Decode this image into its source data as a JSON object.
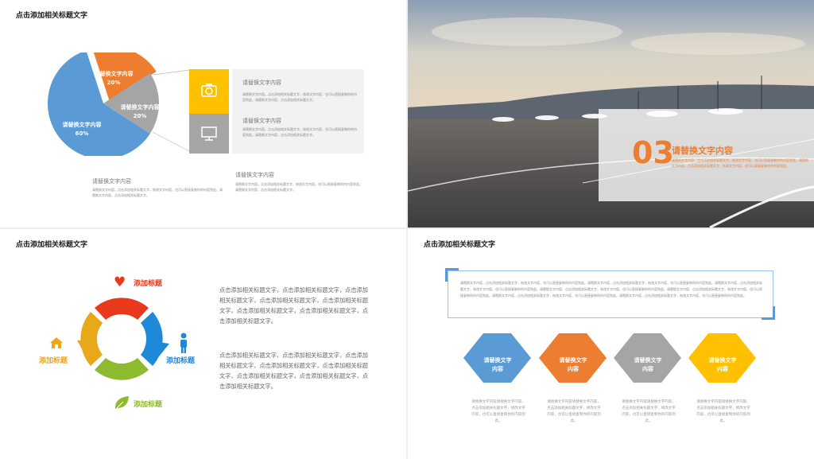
{
  "slide1": {
    "title": "点击添加相关标题文字",
    "pie": [
      {
        "label": "请替换文字内容",
        "percent": "20%",
        "value": 20,
        "color": "#ed7d31"
      },
      {
        "label": "请替换文字内容",
        "percent": "20%",
        "value": 20,
        "color": "#a5a5a5"
      },
      {
        "label": "请替换文字内容",
        "percent": "60%",
        "value": 60,
        "color": "#5b9bd5"
      }
    ],
    "panel_heading_1": "请替换文字内容",
    "panel_text_1": "请替换文字内容。点击添加相关标题文字，修改文字内容，也可以直接复制你的内容到此。请替换文字内容，点击添加相关标题文字。",
    "panel_heading_2": "请替换文字内容",
    "panel_text_2": "请替换文字内容。点击添加相关标题文字，修改文字内容，也可以直接复制你的内容到此。请替换文字内容，点击添加相关标题文字。",
    "bottom_heading_1": "请替换文字内容",
    "bottom_text_1": "请替换文字内容。点击添加相关标题文字，修改文字内容，也可以直接复制你的内容到此。请替换文字内容，点击添加相关标题文字。",
    "bottom_heading_2": "请替换文字内容",
    "bottom_text_2": "请替换文字内容。点击添加相关标题文字，修改文字内容，也可以直接复制你的内容到此。请替换文字内容，点击添加相关标题文字。",
    "icons": [
      "camera-icon",
      "monitor-icon"
    ]
  },
  "slide2": {
    "number": "03",
    "heading": "请替换文字内容",
    "text": "请替换文字内容。点击添加相关标题文字，修改文字内容，也可以直接复制你的内容到此。请替换文字内容，点击添加相关标题文字，修改文字内容，也可以直接复制你的内容到此。",
    "accent": "#ed7d31"
  },
  "slide3": {
    "title": "点击添加相关标题文字",
    "labels": {
      "top": "添加标题",
      "right": "添加标题",
      "bottom": "添加标题",
      "left": "添加标题"
    },
    "icons": [
      "heart-icon",
      "person-icon",
      "leaf-icon",
      "house-icon"
    ],
    "paragraph_1": "点击添加相关标题文字，点击添加相关标题文字，点击添加相关标题文字，点击添加相关标题文字，点击添加相关标题文字，点击添加相关标题文字，点击添加相关标题文字，点击添加相关标题文字。",
    "paragraph_2": "点击添加相关标题文字，点击添加相关标题文字，点击添加相关标题文字，点击添加相关标题文字，点击添加相关标题文字，点击添加相关标题文字，点击添加相关标题文字，点击添加相关标题文字。"
  },
  "slide4": {
    "title": "点击添加相关标题文字",
    "box_text": "请替换文字内容，点击添加相关标题文字，修改文字内容，也可以直接复制你的内容到此。请替换文字内容，点击添加相关标题文字，修改文字内容，也可以直接复制你的内容到此。请替换文字内容，点击添加相关标题文字，修改文字内容，也可以直接复制你的内容到此。请替换文字内容，点击添加相关标题文字，修改文字内容，也可以直接复制你的内容到此。请替换文字内容，点击添加相关标题文字，修改文字内容，也可以直接复制你的内容到此。请替换文字内容，点击添加相关标题文字，修改文字内容，也可以直接复制你的内容到此。请替换文字内容，点击添加相关标题文字，修改文字内容，也可以直接复制你的内容到此。",
    "hexes": [
      {
        "label1": "请替换文字",
        "label2": "内容",
        "color": "#5b9bd5",
        "text": "请替换文字内容请替换文字内容，点击添加相关标题文字，修改文字内容，也可以直接复制你的内容到此。"
      },
      {
        "label1": "请替换文字",
        "label2": "内容",
        "color": "#ed7d31",
        "text": "请替换文字内容请替换文字内容，点击添加相关标题文字，修改文字内容，也可以直接复制你的内容到此。"
      },
      {
        "label1": "请替换文字",
        "label2": "内容",
        "color": "#a5a5a5",
        "text": "请替换文字内容请替换文字内容，点击添加相关标题文字，修改文字内容，也可以直接复制你的内容到此。"
      },
      {
        "label1": "请替换文字",
        "label2": "内容",
        "color": "#ffc000",
        "text": "请替换文字内容请替换文字内容，点击添加相关标题文字，修改文字内容，也可以直接复制你的内容到此。"
      }
    ]
  }
}
